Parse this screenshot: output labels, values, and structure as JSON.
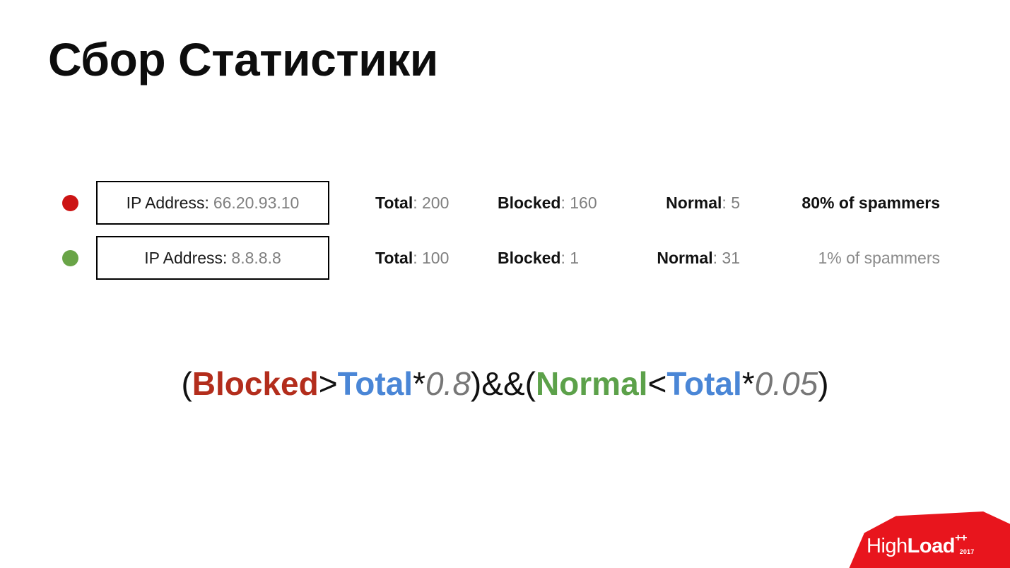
{
  "slide": {
    "title": "Сбор Статистики"
  },
  "colors": {
    "dot_red": "#cc1414",
    "dot_green": "#69a447",
    "keyword_blocked": "#b32d1c",
    "keyword_normal": "#5ca14a",
    "keyword_total": "#4a86d6",
    "number_gray": "#777777",
    "value_gray": "#7f7f7f",
    "logo_red": "#e8151d"
  },
  "stats": {
    "labels": {
      "ip": "IP Address:",
      "total": "Total",
      "blocked": "Blocked",
      "normal": "Normal"
    },
    "rows": [
      {
        "dot_color": "#cc1414",
        "ip_label": "IP Address:",
        "ip_value": "66.20.93.10",
        "total_label": "Total",
        "total_value": "200",
        "blocked_label": "Blocked",
        "blocked_value": "160",
        "normal_label": "Normal",
        "normal_value": "5",
        "spam_text": "80% of spammers",
        "spam_emphasis": "strong"
      },
      {
        "dot_color": "#69a447",
        "ip_label": "IP Address:",
        "ip_value": "8.8.8.8",
        "total_label": "Total",
        "total_value": "100",
        "blocked_label": "Blocked",
        "blocked_value": "1",
        "normal_label": "Normal",
        "normal_value": "31",
        "spam_text": "1% of spammers",
        "spam_emphasis": "muted"
      }
    ]
  },
  "formula": {
    "full_text": "( Blocked > Total * 0.8 ) && ( Normal < Total * 0.05 )",
    "open_paren_1": "(",
    "term_blocked": "Blocked",
    "op_gt": ">",
    "term_total_1": "Total",
    "op_mul_1": "*",
    "num_1": "0.8",
    "close_paren_1": ")",
    "op_and_1": "&",
    "op_and_2": "&",
    "open_paren_2": "(",
    "term_normal": "Normal",
    "op_lt": "<",
    "term_total_2": "Total",
    "op_mul_2": "*",
    "num_2": "0.05",
    "close_paren_2": ")"
  },
  "logo": {
    "part_high": "High",
    "part_load": "Load",
    "part_plus": "++",
    "part_year": "2017"
  }
}
